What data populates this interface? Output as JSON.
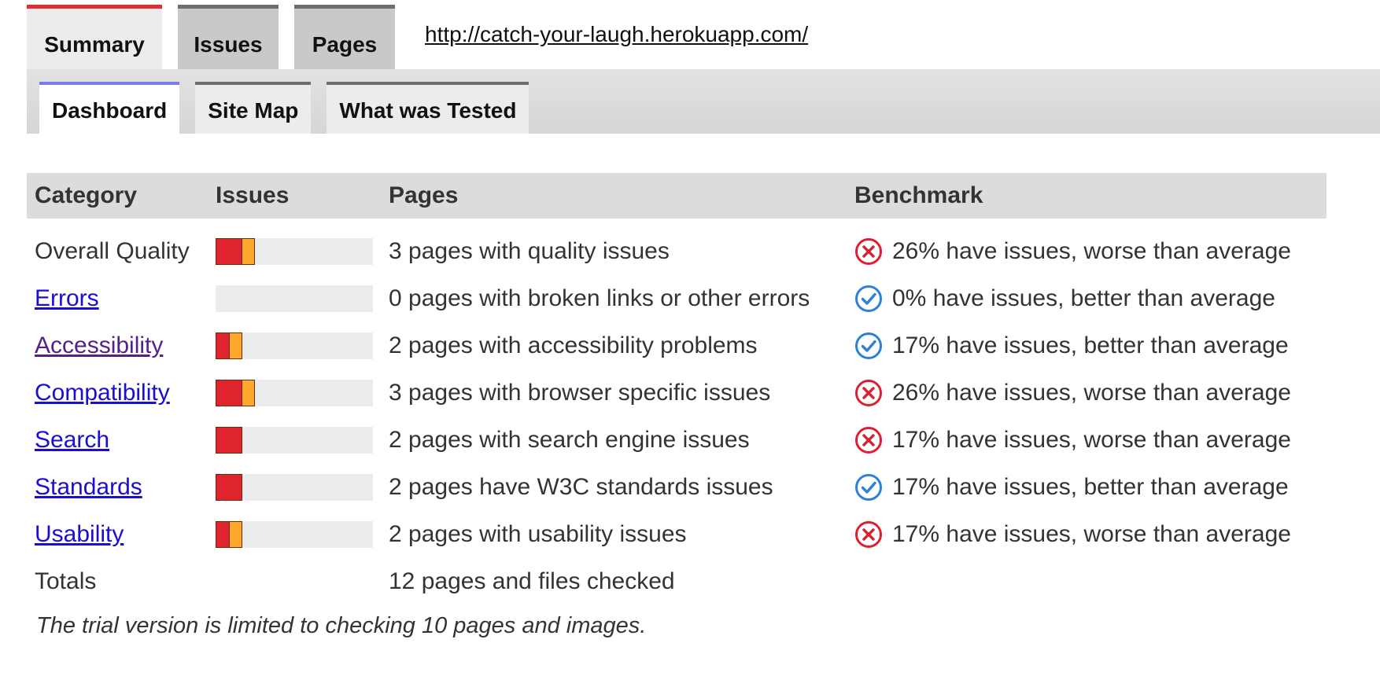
{
  "top_tabs": [
    {
      "label": "Summary",
      "active": true
    },
    {
      "label": "Issues",
      "active": false
    },
    {
      "label": "Pages",
      "active": false
    }
  ],
  "site_url": "http://catch-your-laugh.herokuapp.com/",
  "sub_tabs": [
    {
      "label": "Dashboard",
      "active": true
    },
    {
      "label": "Site Map",
      "active": false
    },
    {
      "label": "What was Tested",
      "active": false
    }
  ],
  "table": {
    "headers": {
      "category": "Category",
      "issues": "Issues",
      "pages": "Pages",
      "benchmark": "Benchmark"
    },
    "rows": [
      {
        "category": "Overall Quality",
        "link": false,
        "red_fraction": 0.17,
        "orange_fraction": 0.08,
        "pages_text": "3 pages with quality issues",
        "benchmark_status": "worse",
        "benchmark_text": "26% have issues, worse than average"
      },
      {
        "category": "Errors",
        "link": true,
        "red_fraction": 0,
        "orange_fraction": 0,
        "pages_text": "0 pages with broken links or other errors",
        "benchmark_status": "better",
        "benchmark_text": "0% have issues, better than average"
      },
      {
        "category": "Accessibility",
        "link": true,
        "visited": true,
        "red_fraction": 0.09,
        "orange_fraction": 0.08,
        "pages_text": "2 pages with accessibility problems",
        "benchmark_status": "better",
        "benchmark_text": "17% have issues, better than average"
      },
      {
        "category": "Compatibility",
        "link": true,
        "red_fraction": 0.17,
        "orange_fraction": 0.08,
        "pages_text": "3 pages with browser specific issues",
        "benchmark_status": "worse",
        "benchmark_text": "26% have issues, worse than average"
      },
      {
        "category": "Search",
        "link": true,
        "red_fraction": 0.17,
        "orange_fraction": 0,
        "pages_text": "2 pages with search engine issues",
        "benchmark_status": "worse",
        "benchmark_text": "17% have issues, worse than average"
      },
      {
        "category": "Standards",
        "link": true,
        "red_fraction": 0.17,
        "orange_fraction": 0,
        "pages_text": "2 pages have W3C standards issues",
        "benchmark_status": "better",
        "benchmark_text": "17% have issues, better than average"
      },
      {
        "category": "Usability",
        "link": true,
        "red_fraction": 0.09,
        "orange_fraction": 0.08,
        "pages_text": "2 pages with usability issues",
        "benchmark_status": "worse",
        "benchmark_text": "17% have issues, worse than average"
      }
    ],
    "totals": {
      "label": "Totals",
      "pages_text": "12 pages and files checked"
    }
  },
  "trial_note": "The trial version is limited to checking 10 pages and images.",
  "colors": {
    "accent_red": "#e02d33",
    "bar_red": "#e0242d",
    "bar_orange": "#ffa82e",
    "better_blue": "#2e7fd6",
    "worse_red": "#d9222b",
    "link_blue": "#1a0dd6",
    "link_visited": "#55208a"
  },
  "icons": {
    "better": "check-circle-icon",
    "worse": "x-circle-icon"
  }
}
